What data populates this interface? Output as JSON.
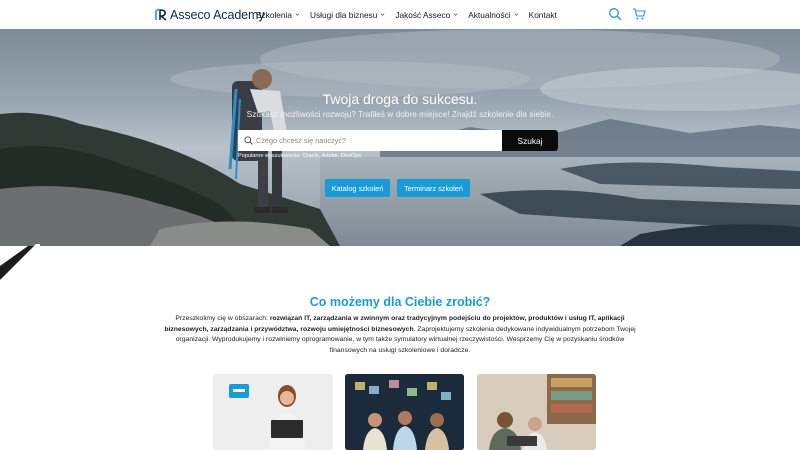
{
  "header": {
    "logo_text": "Asseco Academy",
    "nav": [
      {
        "label": "Szkolenia",
        "has_dropdown": true
      },
      {
        "label": "Usługi dla biznesu",
        "has_dropdown": true
      },
      {
        "label": "Jakość Asseco",
        "has_dropdown": true
      },
      {
        "label": "Aktualności",
        "has_dropdown": true
      },
      {
        "label": "Kontakt",
        "has_dropdown": false
      }
    ],
    "icons": [
      "search-icon",
      "cart-icon"
    ]
  },
  "hero": {
    "title": "Twoja droga do sukcesu.",
    "subtitle": "Szukasz możliwości rozwoju? Trafiłeś w dobre miejsce! Znajdź szkolenie dla siebie.",
    "search_placeholder": "Czego chcesz się nauczyć?",
    "search_button": "Szukaj",
    "popular_label": "Popularne wyszukiwania:",
    "popular_terms": "Oracle, Adobe, DevOps",
    "buttons": [
      "Katalog szkoleń",
      "Terminarz szkoleń"
    ]
  },
  "section": {
    "title": "Co możemy dla Ciebie zrobić?",
    "text_parts": [
      {
        "t": "Przeszkolimy cię w obszarach: ",
        "b": false
      },
      {
        "t": "rozwiązań IT, zarządzania w zwinnym oraz tradycyjnym podejściu do projektów, produktów i usług IT,  aplikacji biznesowych, zarządzania i przywództwa, rozwoju umiejętności biznesowych",
        "b": true
      },
      {
        "t": ". Zaprojektujemy szkolenia dedykowane indywidualnym potrzebom Twojej organizacji. Wyprodukujemy i rozwiniemy oprogramowanie, w tym także symulatory wirtualnej rzeczywistości. Wesprzemy Cię w pozyskaniu środków finansowych na usługi szkoleniowe i doradcze.",
        "b": false
      }
    ],
    "card1_badge": "Asseco Academy"
  },
  "colors": {
    "accent": "#1a9bd7",
    "dark": "#0b0b0b",
    "logo": "#0e2a47"
  }
}
